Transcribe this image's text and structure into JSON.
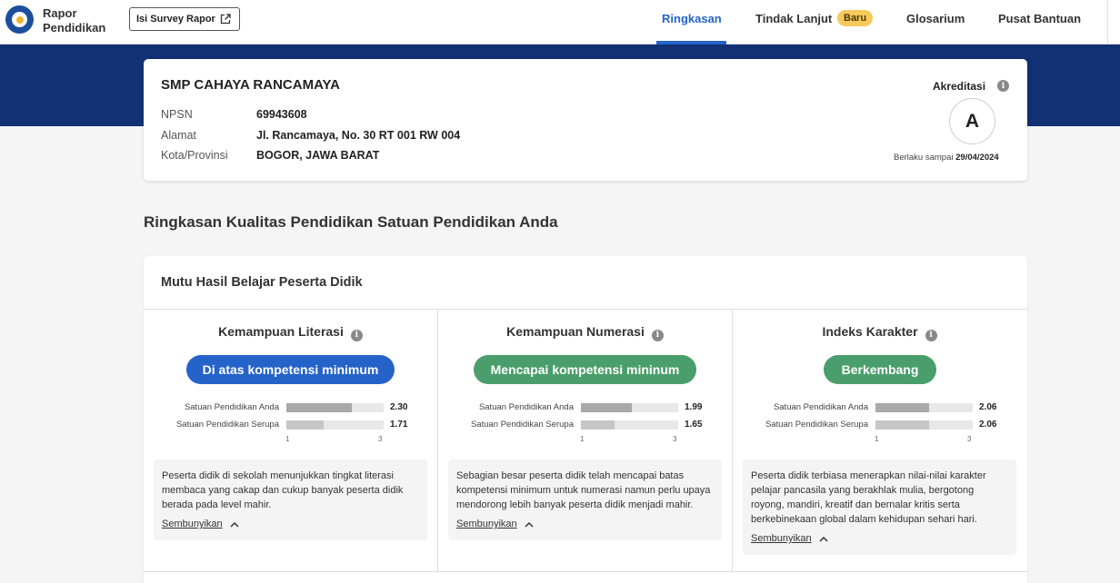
{
  "header": {
    "brand_line1": "Rapor",
    "brand_line2": "Pendidikan",
    "survey_button": "Isi Survey Rapor",
    "nav": [
      {
        "label": "Ringkasan",
        "active": true
      },
      {
        "label": "Tindak Lanjut",
        "badge": "Baru"
      },
      {
        "label": "Glosarium"
      },
      {
        "label": "Pusat Bantuan"
      }
    ]
  },
  "colors": {
    "primary": "#2563c9",
    "band": "#123074",
    "green_pill": "#4a9e6b",
    "badge": "#f6c95b",
    "bar_school": "#a9a9a9",
    "bar_similar": "#c6c6c6"
  },
  "school": {
    "name": "SMP CAHAYA RANCAMAYA",
    "npsn_label": "NPSN",
    "npsn": "69943608",
    "alamat_label": "Alamat",
    "alamat": "Jl. Rancamaya, No. 30 RT 001 RW 004",
    "kota_label": "Kota/Provinsi",
    "kota": "BOGOR, JAWA BARAT",
    "akreditasi_label": "Akreditasi",
    "akreditasi": "A",
    "berlaku_label": "Berlaku sampai",
    "berlaku_date": "29/04/2024"
  },
  "section_title": "Ringkasan Kualitas Pendidikan Satuan Pendidikan Anda",
  "mutu": {
    "title": "Mutu Hasil Belajar Peserta Didik",
    "columns": [
      {
        "title": "Kemampuan Literasi",
        "status": "Di atas kompetensi minimum",
        "status_color": "#2563c9",
        "rows": [
          {
            "label": "Satuan Pendidikan Anda",
            "value": 2.3
          },
          {
            "label": "Satuan Pendidikan Serupa",
            "value": 1.71
          }
        ],
        "tick_min": "1",
        "tick_max": "3",
        "desc": "Peserta didik di sekolah menunjukkan tingkat literasi membaca yang cakap dan cukup banyak peserta didik berada pada level mahir.",
        "hide": "Sembunyikan"
      },
      {
        "title": "Kemampuan Numerasi",
        "status": "Mencapai kompetensi mininum",
        "status_color": "#4a9e6b",
        "rows": [
          {
            "label": "Satuan Pendidikan Anda",
            "value": 1.99
          },
          {
            "label": "Satuan Pendidikan Serupa",
            "value": 1.65
          }
        ],
        "tick_min": "1",
        "tick_max": "3",
        "desc": "Sebagian besar peserta didik telah mencapai batas kompetensi minimum untuk numerasi namun perlu upaya mendorong lebih banyak peserta didik menjadi mahir.",
        "hide": "Sembunyikan"
      },
      {
        "title": "Indeks Karakter",
        "status": "Berkembang",
        "status_color": "#4a9e6b",
        "rows": [
          {
            "label": "Satuan Pendidikan Anda",
            "value": 2.06
          },
          {
            "label": "Satuan Pendidikan Serupa",
            "value": 2.06
          }
        ],
        "tick_min": "1",
        "tick_max": "3",
        "desc": "Peserta didik terbiasa menerapkan nilai-nilai karakter pelajar pancasila yang berakhlak mulia, bergotong royong, mandiri, kreatif dan bernalar kritis serta berkebinekaan global dalam kehidupan sehari hari.",
        "hide": "Sembunyikan"
      }
    ]
  }
}
